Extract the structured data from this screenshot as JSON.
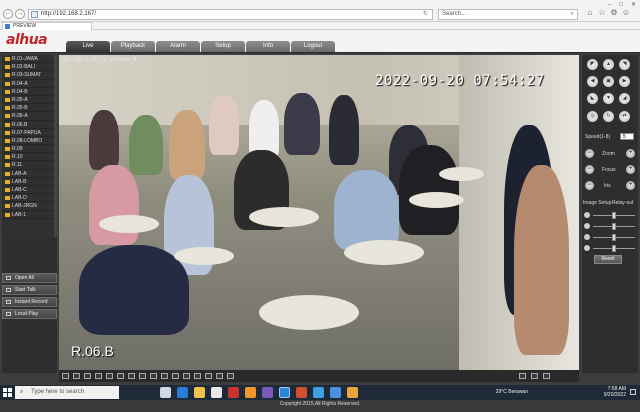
{
  "browser": {
    "address": "http://192.168.2.167/",
    "search_placeholder": "Search...",
    "tab_title": "PREVIEW",
    "nav_back": "←",
    "nav_forward": "→"
  },
  "app": {
    "logo": "alhua",
    "menu": [
      {
        "label": "Live",
        "active": true
      },
      {
        "label": "Playback",
        "active": false
      },
      {
        "label": "Alarm",
        "active": false
      },
      {
        "label": "Setup",
        "active": false
      },
      {
        "label": "Info",
        "active": false
      },
      {
        "label": "Logout",
        "active": false
      }
    ]
  },
  "cameras": [
    "R.01-JAWA",
    "R.02-BALI",
    "R.03-SUMAT",
    "R.04-A",
    "R.04-B",
    "R.05-A",
    "R.05-B",
    "R.06-A",
    "R.06.B",
    "R.07-PAPUA",
    "R.08-LOMBO",
    "R.09",
    "R.10",
    "R.11",
    "LAB-A",
    "LAB-B",
    "LAB-C",
    "LAB-D",
    "LAB-JRGN",
    "LAB-1"
  ],
  "left_actions": [
    "Open All",
    "Start Talk",
    "Instant Record",
    "Local Play"
  ],
  "video": {
    "stamp": "192.168.2.167_9_10kbbps_M",
    "timestamp": "2022-09-20 07:54:27",
    "camera_label": "R.06.B"
  },
  "ptz": {
    "speed_label": "Speed(1-8)",
    "speed_value": "5",
    "zoom_label": "Zoom",
    "focus_label": "Focus",
    "iris_label": "Iris"
  },
  "image_tabs": {
    "image_setup": "Image Setup",
    "relay_out": "Relay-out"
  },
  "image_sliders": [
    {
      "name": "brightness",
      "level": 0.5
    },
    {
      "name": "contrast",
      "level": 0.5
    },
    {
      "name": "saturation",
      "level": 0.5
    },
    {
      "name": "hue",
      "level": 0.5
    }
  ],
  "reset_label": "Reset",
  "footer": "Copyright 2015,All Rights Reserved.",
  "taskbar": {
    "search_placeholder": "Type here to search",
    "weather": "29°C  Berawan",
    "time": "7:58 AM",
    "date": "9/20/2022"
  }
}
